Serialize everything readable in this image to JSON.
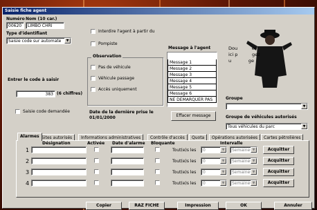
{
  "window": {
    "title": "Saisie fiche agent"
  },
  "header": {
    "numero_label": "Numéro",
    "nom_label": "Nom  (10 car.)",
    "numero_value": "00620",
    "nom_value": "LIMBO CHRI",
    "type_label": "Type d'identifiant",
    "type_value": "Saisie code sur automate",
    "code_label": "Entrer le code à saisir",
    "code_value": "383",
    "code_hint": "(6 chiffres)",
    "saisie_demandee_label": "Saisie code demandée"
  },
  "options": {
    "interdire_label": "Interdire l'agent à partir du",
    "pompiste_label": "Pompiste",
    "observation_title": "Observation",
    "pas_vehicule_label": "Pas de véhicule",
    "vehicule_passage_label": "Véhicule passage",
    "acces_uniquement_label": "Accès uniquement",
    "derniere_prise_label": "Date de la dernière prise le",
    "derniere_prise_value": "01/01/2000"
  },
  "messages": {
    "title": "Message à l'agent",
    "items": [
      "Message 1",
      "Message 2",
      "Message 3",
      "Message 4",
      "Message 5",
      "Message 6",
      "NE DEMARQUER PAS"
    ],
    "clear_button": "Effacer message"
  },
  "photo_caption": "Dou          er\nici p          gez\nu            ge",
  "groupe": {
    "label": "Groupe",
    "value": "",
    "vehicules_label": "Groupe de véhicules autorisés",
    "vehicules_value": "Tous véhicules du parc"
  },
  "tabs": [
    {
      "label": "Alarmes",
      "active": true
    },
    {
      "label": "Sites autorisés"
    },
    {
      "label": "Informations administratives"
    },
    {
      "label": "Contrôle d'accès"
    },
    {
      "label": "Quota"
    },
    {
      "label": "Opérations autorisées"
    },
    {
      "label": "Cartes pétrolières"
    }
  ],
  "alarmes": {
    "headers": {
      "designation": "Désignation",
      "activee": "Activée",
      "date": "Date d'alarme",
      "bloquante": "Bloquante",
      "intervalle": "Intervalle"
    },
    "rows": [
      {
        "num": "1",
        "toutes": "Tout(e)s les",
        "qty": "0",
        "unit": "Semaine(s)",
        "ack": "Acquitter"
      },
      {
        "num": "2",
        "toutes": "Tout(e)s les",
        "qty": "0",
        "unit": "Semaine(s)",
        "ack": "Acquitter"
      },
      {
        "num": "3",
        "toutes": "Tout(e)s les",
        "qty": "0",
        "unit": "Semaine(s)",
        "ack": "Acquitter"
      },
      {
        "num": "4",
        "toutes": "Tout(e)s les",
        "qty": "0",
        "unit": "Semaine(s)",
        "ack": "Acquitter"
      }
    ]
  },
  "footer": {
    "copier": "Copier",
    "raz": "RAZ FICHE",
    "impression": "Impression",
    "ok": "OK",
    "annuler": "Annuler"
  }
}
